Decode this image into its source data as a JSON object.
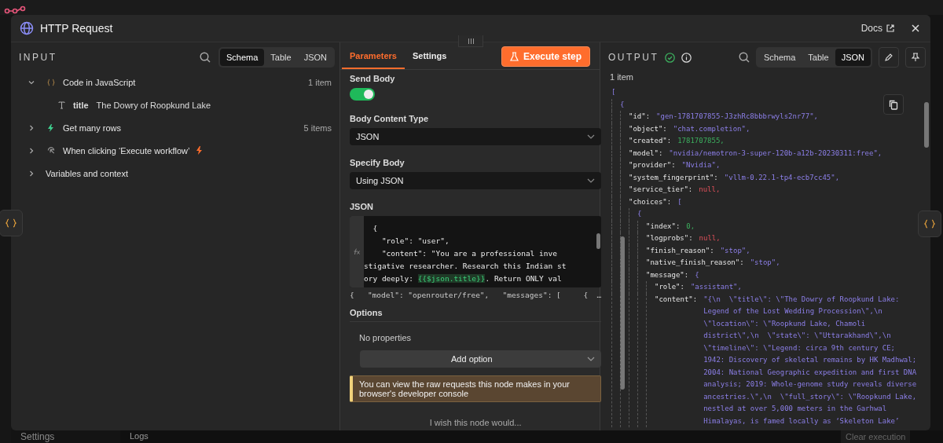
{
  "background": {
    "settings_label": "Settings",
    "logs_label": "Logs",
    "clear_button": "Clear execution"
  },
  "modal": {
    "title": "HTTP Request",
    "docs_link": "Docs"
  },
  "input": {
    "heading": "INPUT",
    "views": [
      {
        "label": "Schema",
        "selected": true
      },
      {
        "label": "Table",
        "selected": false
      },
      {
        "label": "JSON",
        "selected": false
      }
    ],
    "tree": [
      {
        "label": "Code in JavaScript",
        "kind": "code",
        "count": "1 item",
        "expanded": true,
        "children": [
          {
            "field": "title",
            "value": "The Dowry of Roopkund Lake"
          }
        ]
      },
      {
        "label": "Get many rows",
        "kind": "rows",
        "count": "5 items",
        "expanded": false
      },
      {
        "label": "When clicking ‘Execute workflow’",
        "kind": "trigger",
        "expanded": false
      },
      {
        "label": "Variables and context",
        "kind": "plain",
        "expanded": false
      }
    ]
  },
  "parameters": {
    "tabs": [
      {
        "label": "Parameters",
        "selected": true
      },
      {
        "label": "Settings",
        "selected": false
      }
    ],
    "execute_button": "Execute step",
    "send_body": {
      "label": "Send Body",
      "on": true
    },
    "body_content_type": {
      "label": "Body Content Type",
      "value": "JSON"
    },
    "specify_body": {
      "label": "Specify Body",
      "value": "Using JSON"
    },
    "json_field": {
      "label": "JSON",
      "lines": [
        [
          {
            "text": "  {"
          }
        ],
        [
          {
            "text": "    \"role\": \"user\","
          }
        ],
        [
          {
            "text": "    \"content\": \"You are a professional inve"
          }
        ],
        [
          {
            "text": "stigative researcher. Research this Indian st"
          }
        ],
        [
          {
            "text": "ory deeply: "
          },
          {
            "text": "{{$json.title}}",
            "kind": "expression"
          },
          {
            "text": ". Return ONLY val"
          }
        ]
      ],
      "preview": "{   \"model\": \"openrouter/free\",   \"messages\": [     {  …"
    },
    "options": {
      "label": "Options",
      "empty": "No properties",
      "add_button": "Add option"
    },
    "notice": "You can view the raw requests this node makes in your browser's developer console",
    "feedback": "I wish this node would..."
  },
  "output": {
    "heading": "OUTPUT",
    "views": [
      {
        "label": "Schema",
        "selected": false
      },
      {
        "label": "Table",
        "selected": false
      },
      {
        "label": "JSON",
        "selected": true
      }
    ],
    "count": "1 item",
    "json": [
      {
        "open": "[",
        "children": [
          {
            "open": "{",
            "children": [
              {
                "key": "\"id\":",
                "value": "\"gen-1781707855-J3zhRc8bbbrwyls2nr77\",",
                "kind": "string"
              },
              {
                "key": "\"object\":",
                "value": "\"chat.completion\",",
                "kind": "string"
              },
              {
                "key": "\"created\":",
                "value": "1781707855,",
                "kind": "number"
              },
              {
                "key": "\"model\":",
                "value": "\"nvidia/nemotron-3-super-120b-a12b-20230311:free\",",
                "kind": "string"
              },
              {
                "key": "\"provider\":",
                "value": "\"Nvidia\",",
                "kind": "string"
              },
              {
                "key": "\"system_fingerprint\":",
                "value": "\"vllm-0.22.1-tp4-ecb7cc45\",",
                "kind": "string"
              },
              {
                "key": "\"service_tier\":",
                "value": "null,",
                "kind": "null"
              },
              {
                "key": "\"choices\":",
                "open": "[",
                "children": [
                  {
                    "open": "{",
                    "children": [
                      {
                        "key": "\"index\":",
                        "value": "0,",
                        "kind": "number"
                      },
                      {
                        "key": "\"logprobs\":",
                        "value": "null,",
                        "kind": "null"
                      },
                      {
                        "key": "\"finish_reason\":",
                        "value": "\"stop\",",
                        "kind": "string"
                      },
                      {
                        "key": "\"native_finish_reason\":",
                        "value": "\"stop\",",
                        "kind": "string"
                      },
                      {
                        "key": "\"message\":",
                        "open": "{",
                        "children": [
                          {
                            "key": "\"role\":",
                            "value": "\"assistant\",",
                            "kind": "string"
                          },
                          {
                            "key": "\"content\":",
                            "value": "\"{\\n  \\\"title\\\": \\\"The Dowry of Roopkund Lake: Legend of the Lost Wedding Procession\\\",\\n  \\\"location\\\": \\\"Roopkund Lake, Chamoli district\\\",\\n  \\\"state\\\": \\\"Uttarakhand\\\",\\n  \\\"timeline\\\": \\\"Legend: circa 9th century CE; 1942: Discovery of skeletal remains by HK Madhwal; 2004: National Geographic expedition and first DNA analysis; 2019: Whole-genome study reveals diverse ancestries.\\\",\\n  \\\"full_story\\\": \\\"Roopkund Lake, nestled at over 5,000 meters in the Garhwal Himalayas, is famed locally as ‘Skeleton Lake’",
                            "kind": "string"
                          }
                        ]
                      }
                    ]
                  }
                ]
              }
            ]
          }
        ]
      }
    ]
  }
}
